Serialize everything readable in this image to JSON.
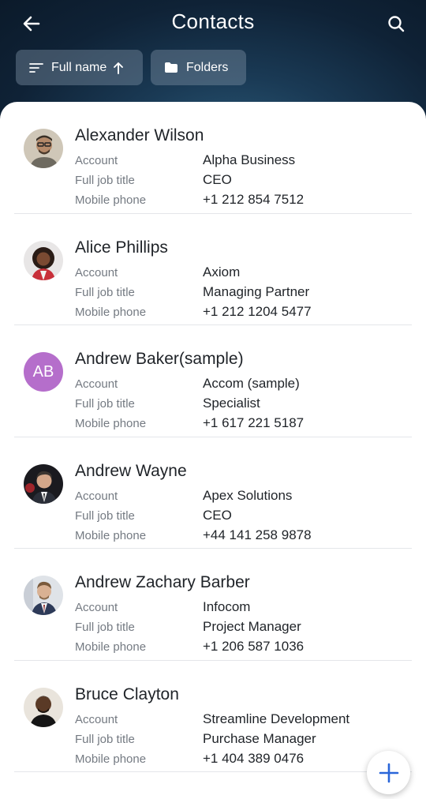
{
  "header": {
    "title": "Contacts",
    "sort_label": "Full name",
    "folders_label": "Folders"
  },
  "contacts": [
    {
      "name": "Alexander Wilson",
      "account": "Alpha Business",
      "job_title": "CEO",
      "phone": "+1 212 854 7512",
      "avatar": "photo"
    },
    {
      "name": "Alice Phillips",
      "account": "Axiom",
      "job_title": "Managing Partner",
      "phone": "+1 212 1204 5477",
      "avatar": "photo"
    },
    {
      "name": "Andrew Baker(sample)",
      "account": "Accom (sample)",
      "job_title": "Specialist",
      "phone": "+1 617 221 5187",
      "avatar": "initials",
      "initials": "AB"
    },
    {
      "name": "Andrew Wayne",
      "account": "Apex Solutions",
      "job_title": "CEO",
      "phone": "+44 141 258 9878",
      "avatar": "photo"
    },
    {
      "name": "Andrew Zachary Barber",
      "account": "Infocom",
      "job_title": "Project Manager",
      "phone": "+1 206 587 1036",
      "avatar": "photo"
    },
    {
      "name": "Bruce Clayton",
      "account": "Streamline Development",
      "job_title": "Purchase Manager",
      "phone": "+1 404 389 0476",
      "avatar": "photo"
    }
  ],
  "labels": {
    "account": "Account",
    "job_title": "Full job title",
    "phone": "Mobile phone"
  },
  "icons": {
    "back": "arrow-left-icon",
    "search": "search-icon",
    "sort": "sort-lines-icon",
    "sort_dir": "arrow-up-icon",
    "folder": "folder-icon",
    "add": "plus-icon"
  },
  "colors": {
    "header_dark": "#0f2236",
    "initials_avatar": "#b56ecb",
    "fab_plus": "#2a66d9"
  }
}
